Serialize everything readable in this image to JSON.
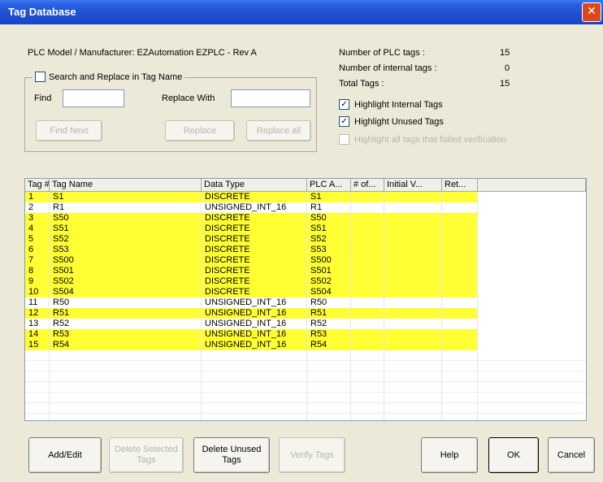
{
  "window": {
    "title": "Tag Database",
    "close_glyph": "✕"
  },
  "model_label": "PLC Model / Manufacturer:  EZAutomation EZPLC  - Rev A",
  "stats": {
    "plc_tags_label": "Number of PLC  tags :",
    "plc_tags_value": "15",
    "internal_tags_label": "Number of internal tags :",
    "internal_tags_value": "0",
    "total_tags_label": "Total Tags :",
    "total_tags_value": "15"
  },
  "options": {
    "highlight_internal": {
      "label": "Highlight Internal Tags",
      "checked": true
    },
    "highlight_unused": {
      "label": "Highlight Unused Tags",
      "checked": true
    },
    "highlight_failed": {
      "label": "Highlight all tags that failed verification",
      "checked": false
    }
  },
  "search": {
    "group_label": "Search and Replace in Tag Name",
    "find_label": "Find",
    "replace_label": "Replace With",
    "find_value": "",
    "replace_value": "",
    "find_next": "Find Next",
    "replace": "Replace",
    "replace_all": "Replace all"
  },
  "table": {
    "columns": [
      "Tag #",
      "Tag Name",
      "Data Type",
      "PLC A...",
      "# of...",
      "Initial V...",
      "Ret..."
    ],
    "rows": [
      {
        "num": "1",
        "name": "S1",
        "type": "DISCRETE",
        "addr": "S1",
        "hl": true
      },
      {
        "num": "2",
        "name": "R1",
        "type": "UNSIGNED_INT_16",
        "addr": "R1",
        "hl": false
      },
      {
        "num": "3",
        "name": "S50",
        "type": "DISCRETE",
        "addr": "S50",
        "hl": true
      },
      {
        "num": "4",
        "name": "S51",
        "type": "DISCRETE",
        "addr": "S51",
        "hl": true
      },
      {
        "num": "5",
        "name": "S52",
        "type": "DISCRETE",
        "addr": "S52",
        "hl": true
      },
      {
        "num": "6",
        "name": "S53",
        "type": "DISCRETE",
        "addr": "S53",
        "hl": true
      },
      {
        "num": "7",
        "name": "S500",
        "type": "DISCRETE",
        "addr": "S500",
        "hl": true
      },
      {
        "num": "8",
        "name": "S501",
        "type": "DISCRETE",
        "addr": "S501",
        "hl": true
      },
      {
        "num": "9",
        "name": "S502",
        "type": "DISCRETE",
        "addr": "S502",
        "hl": true
      },
      {
        "num": "10",
        "name": "S504",
        "type": "DISCRETE",
        "addr": "S504",
        "hl": true
      },
      {
        "num": "11",
        "name": "R50",
        "type": "UNSIGNED_INT_16",
        "addr": "R50",
        "hl": false
      },
      {
        "num": "12",
        "name": "R51",
        "type": "UNSIGNED_INT_16",
        "addr": "R51",
        "hl": true
      },
      {
        "num": "13",
        "name": "R52",
        "type": "UNSIGNED_INT_16",
        "addr": "R52",
        "hl": false
      },
      {
        "num": "14",
        "name": "R53",
        "type": "UNSIGNED_INT_16",
        "addr": "R53",
        "hl": true
      },
      {
        "num": "15",
        "name": "R54",
        "type": "UNSIGNED_INT_16",
        "addr": "R54",
        "hl": true
      }
    ]
  },
  "buttons": {
    "add_edit": "Add/Edit",
    "delete_selected": "Delete Selected Tags",
    "delete_unused": "Delete Unused Tags",
    "verify": "Verify Tags",
    "help": "Help",
    "ok": "OK",
    "cancel": "Cancel"
  },
  "colors": {
    "highlight": "#ffff33",
    "titlebar": "#2a5fe0"
  }
}
